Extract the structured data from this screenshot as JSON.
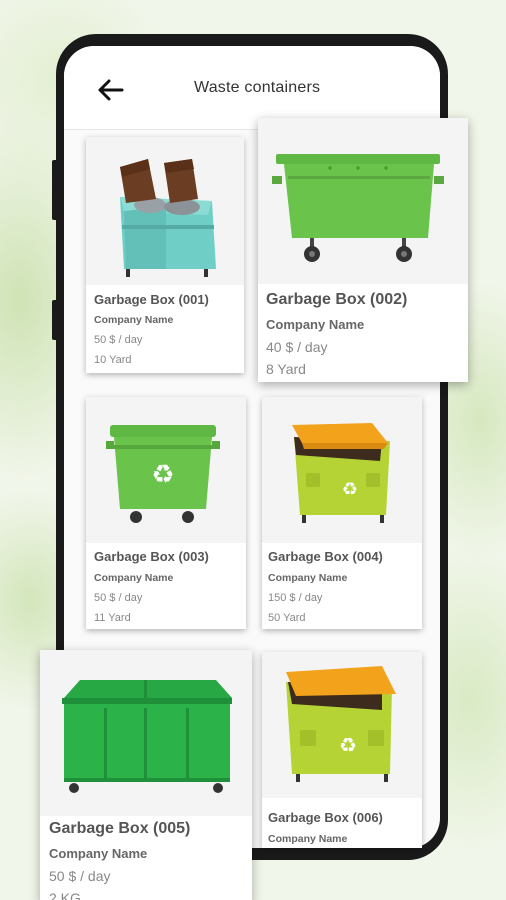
{
  "header": {
    "title": "Waste containers"
  },
  "icons": {
    "back": "arrow-left-icon"
  },
  "colors": {
    "bin_green": "#6ac34a",
    "bin_teal": "#6fcfc6",
    "lid_orange": "#f2a21b",
    "lid_brown": "#6b3d22"
  },
  "cards": [
    {
      "name": "Garbage Box (001)",
      "company": "Company Name",
      "price": "50 $ / day",
      "size": "10 Yard"
    },
    {
      "name": "Garbage Box (002)",
      "company": "Company Name",
      "price": "40 $ / day",
      "size": "8 Yard"
    },
    {
      "name": "Garbage Box (003)",
      "company": "Company Name",
      "price": "50 $ / day",
      "size": "11 Yard"
    },
    {
      "name": "Garbage Box (004)",
      "company": "Company Name",
      "price": "150 $ / day",
      "size": "50 Yard"
    },
    {
      "name": "Garbage Box (005)",
      "company": "Company Name",
      "price": "50 $ / day",
      "size": "2 KG"
    },
    {
      "name": "Garbage Box (006)",
      "company": "Company Name"
    }
  ]
}
